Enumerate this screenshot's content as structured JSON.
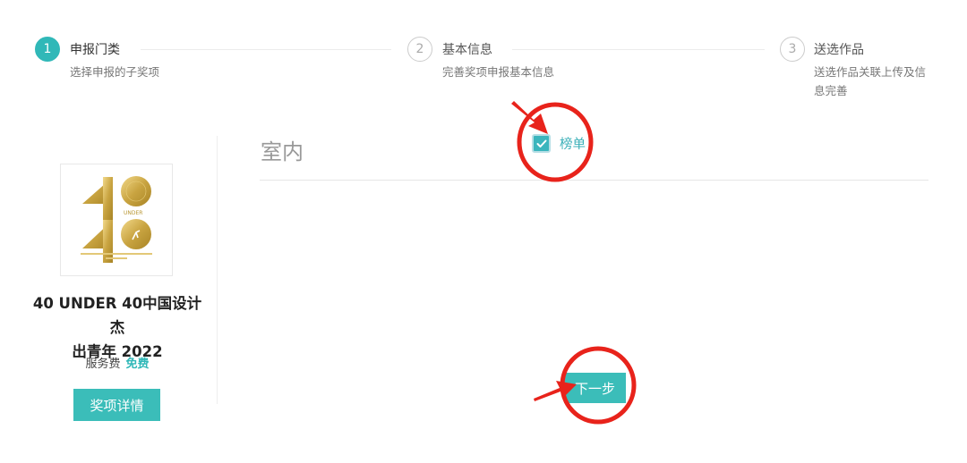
{
  "steps": [
    {
      "number": "1",
      "title": "申报门类",
      "desc": "选择申报的子奖项"
    },
    {
      "number": "2",
      "title": "基本信息",
      "desc": "完善奖项申报基本信息"
    },
    {
      "number": "3",
      "title": "送选作品",
      "desc_line1": "送选作品关联上传及信",
      "desc_line2": "息完善"
    }
  ],
  "award": {
    "logo_text": "UNDER",
    "name_line1": "40 UNDER 40中国设计杰",
    "name_line2": "出青年 2022",
    "fee_label": "服务费",
    "fee_value": "免费",
    "details_button": "奖项详情"
  },
  "category": {
    "title": "室内",
    "option_label": "榜单",
    "option_checked": true
  },
  "next_button": "下一步",
  "colors": {
    "accent": "#30b8b8",
    "annotation": "#e8231b",
    "gold": "#c9a441"
  }
}
